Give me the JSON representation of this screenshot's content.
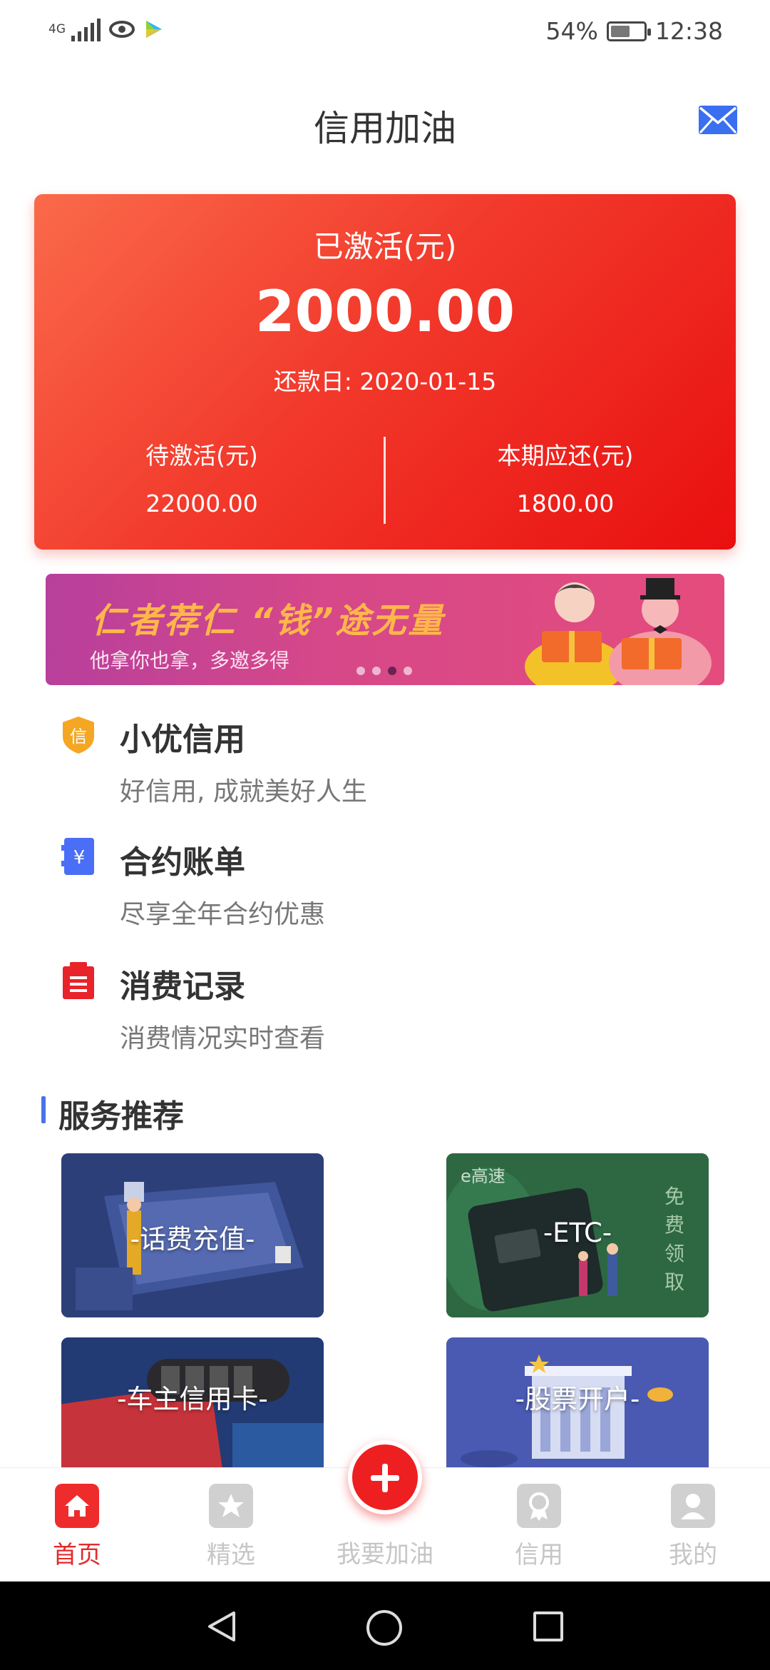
{
  "status_bar": {
    "network": "4G",
    "battery": "54%",
    "time": "12:38",
    "icons": [
      "signal-icon",
      "eye-icon",
      "play-icon",
      "battery-icon"
    ]
  },
  "header": {
    "title": "信用加油",
    "mail_icon": "mail-icon"
  },
  "balance_card": {
    "label": "已激活(元)",
    "amount": "2000.00",
    "due_date": "还款日: 2020-01-15",
    "pending_label": "待激活(元)",
    "pending_value": "22000.00",
    "current_label": "本期应还(元)",
    "current_value": "1800.00"
  },
  "banner": {
    "title": "仁者荐仁 “钱”途无量",
    "subtitle": "他拿你也拿，多邀多得",
    "dots": 4,
    "active_dot": 3
  },
  "features": [
    {
      "icon": "shield-credit-icon",
      "title": "小优信用",
      "desc": "好信用, 成就美好人生"
    },
    {
      "icon": "yen-bill-icon",
      "title": "合约账单",
      "desc": "尽享全年合约优惠"
    },
    {
      "icon": "receipt-icon",
      "title": "消费记录",
      "desc": "消费情况实时查看"
    }
  ],
  "services_section": {
    "title": "服务推荐",
    "items": [
      {
        "label": "-话费充值-"
      },
      {
        "label": "-ETC-",
        "brand": "e高速",
        "side_text": "免费领取"
      },
      {
        "label": "-车主信用卡-"
      },
      {
        "label": "-股票开户-"
      }
    ]
  },
  "bottom_nav": {
    "items": [
      {
        "label": "首页",
        "icon": "home-icon"
      },
      {
        "label": "精选",
        "icon": "star-icon"
      },
      {
        "label": "我要加油",
        "icon": "plus-icon"
      },
      {
        "label": "信用",
        "icon": "badge-icon"
      },
      {
        "label": "我的",
        "icon": "user-icon"
      }
    ]
  },
  "colors": {
    "accent_red": "#ee2c2c",
    "card_gradient_start": "#fa6a4a",
    "card_gradient_end": "#e90f10",
    "section_bar": "#4a73e8"
  }
}
